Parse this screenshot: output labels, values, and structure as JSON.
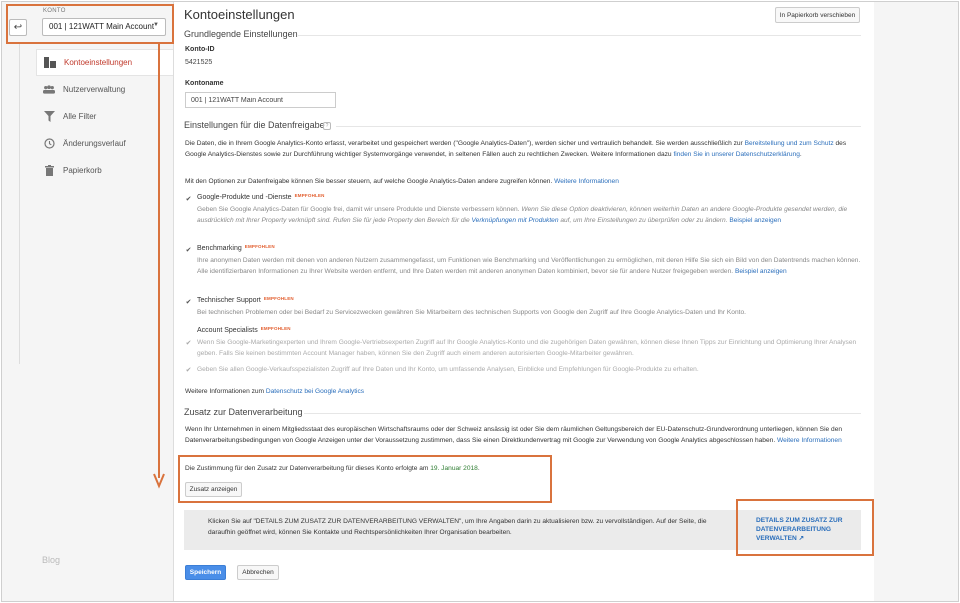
{
  "sidebar": {
    "konto_label": "KONTO",
    "account": "001 | 121WATT Main Account",
    "items": [
      {
        "label": "Kontoeinstellungen",
        "icon": "building-icon",
        "active": true
      },
      {
        "label": "Nutzerverwaltung",
        "icon": "users-icon",
        "active": false
      },
      {
        "label": "Alle Filter",
        "icon": "filter-icon",
        "active": false
      },
      {
        "label": "Änderungsverlauf",
        "icon": "history-icon",
        "active": false
      },
      {
        "label": "Papierkorb",
        "icon": "trash-icon",
        "active": false
      }
    ],
    "blog": "Blog"
  },
  "main": {
    "title": "Kontoeinstellungen",
    "trash_button": "In Papierkorb verschieben",
    "basic_heading": "Grundlegende Einstellungen",
    "konto_id_label": "Konto-ID",
    "konto_id_value": "5421525",
    "kontoname_label": "Kontoname",
    "kontoname_value": "001 | 121WATT Main Account",
    "sharing_heading": "Einstellungen für die Datenfreigabe",
    "sharing_help": "?",
    "intro_1": "Die Daten, die in Ihrem Google Analytics-Konto erfasst, verarbeitet und gespeichert werden (\"Google Analytics-Daten\"), werden sicher und vertraulich behandelt. Sie werden ausschließlich zur ",
    "intro_link_1": "Bereitstellung und zum Schutz",
    "intro_2": " des Google Analytics-Dienstes sowie zur Durchführung wichtiger Systemvorgänge verwendet, in seltenen Fällen auch zu rechtlichen Zwecken. Weitere Informationen dazu ",
    "intro_link_2": "finden Sie in unserer Datenschutzerklärung",
    "intro_3": ".",
    "options_intro": "Mit den Optionen zur Datenfreigabe können Sie besser steuern, auf welche Google Analytics-Daten andere zugreifen können. ",
    "options_intro_link": "Weitere Informationen",
    "recommended": "EMPFOHLEN",
    "opt1_title": "Google-Produkte und -Dienste",
    "opt1_desc_a": "Geben Sie Google Analytics-Daten für Google frei, damit wir unsere Produkte und Dienste verbessern können. ",
    "opt1_desc_b": "Wenn Sie diese Option deaktivieren, können weiterhin Daten an andere Google-Produkte gesendet werden, die ausdrücklich mit Ihrer Property verknüpft sind. Rufen Sie für jede Property den Bereich für die ",
    "opt1_link": "Verknüpfungen mit Produkten",
    "opt1_desc_c": " auf, um Ihre Einstellungen zu überprüfen oder zu ändern.",
    "opt1_example": "Beispiel anzeigen",
    "opt2_title": "Benchmarking",
    "opt2_desc": "Ihre anonymen Daten werden mit denen von anderen Nutzern zusammengefasst, um Funktionen wie Benchmarking und Veröffentlichungen zu ermöglichen, mit deren Hilfe Sie sich ein Bild von den Datentrends machen können. Alle identifizierbaren Informationen zu Ihrer Website werden entfernt, und Ihre Daten werden mit anderen anonymen Daten kombiniert, bevor sie für andere Nutzer freigegeben werden. ",
    "opt2_example": "Beispiel anzeigen",
    "opt3_title": "Technischer Support",
    "opt3_desc": "Bei technischen Problemen oder bei Bedarf zu Servicezwecken gewähren Sie Mitarbeitern des technischen Supports von Google den Zugriff auf Ihre Google Analytics-Daten und Ihr Konto.",
    "opt4_title": "Account Specialists",
    "opt4_desc": "Wenn Sie Google-Marketingexperten und Ihrem Google-Vertriebsexperten Zugriff auf Ihr Google Analytics-Konto und die zugehörigen Daten gewähren, können diese Ihnen Tipps zur Einrichtung und Optimierung Ihrer Analysen geben. Falls Sie keinen bestimmten Account Manager haben, können Sie den Zugriff auch einem anderen autorisierten Google-Mitarbeiter gewähren.",
    "opt5_desc": "Geben Sie allen Google-Verkaufsspezialisten Zugriff auf Ihre Daten und Ihr Konto, um umfassende Analysen, Einblicke und Empfehlungen für Google-Produkte zu erhalten.",
    "privacy_more": "Weitere Informationen zum ",
    "privacy_link": "Datenschutz bei Google Analytics",
    "addendum_heading": "Zusatz zur Datenverarbeitung",
    "addendum_text": "Wenn Ihr Unternehmen in einem Mitgliedsstaat des europäischen Wirtschaftsraums oder der Schweiz ansässig ist oder Sie dem räumlichen Geltungsbereich der EU-Datenschutz-Grundverordnung unterliegen, können Sie den Datenverarbeitungsbedingungen von Google Anzeigen unter der Voraussetzung zustimmen, dass Sie einen Direktkundenvertrag mit Google zur Verwendung von Google Analytics abgeschlossen haben. ",
    "addendum_link": "Weitere Informationen",
    "consent_text": "Die Zustimmung für den Zusatz zur Datenverarbeitung für dieses Konto erfolgte am ",
    "consent_date": "19. Januar 2018",
    "consent_end": ".",
    "show_addendum_button": "Zusatz anzeigen",
    "info_text": "Klicken Sie auf \"DETAILS ZUM ZUSATZ ZUR DATENVERARBEITUNG VERWALTEN\", um Ihre Angaben darin zu aktualisieren bzw. zu vervollständigen. Auf der Seite, die daraufhin geöffnet wird, können Sie Kontakte und Rechtspersönlichkeiten Ihrer Organisation bearbeiten.",
    "info_link": "DETAILS ZUM ZUSATZ ZUR DATENVERARBEITUNG VERWALTEN",
    "save_button": "Speichern",
    "cancel_button": "Abbrechen"
  },
  "colors": {
    "highlight": "#d9733d",
    "link": "#2a6ebb",
    "accent": "#c0392b",
    "primary": "#4a8ee8"
  }
}
